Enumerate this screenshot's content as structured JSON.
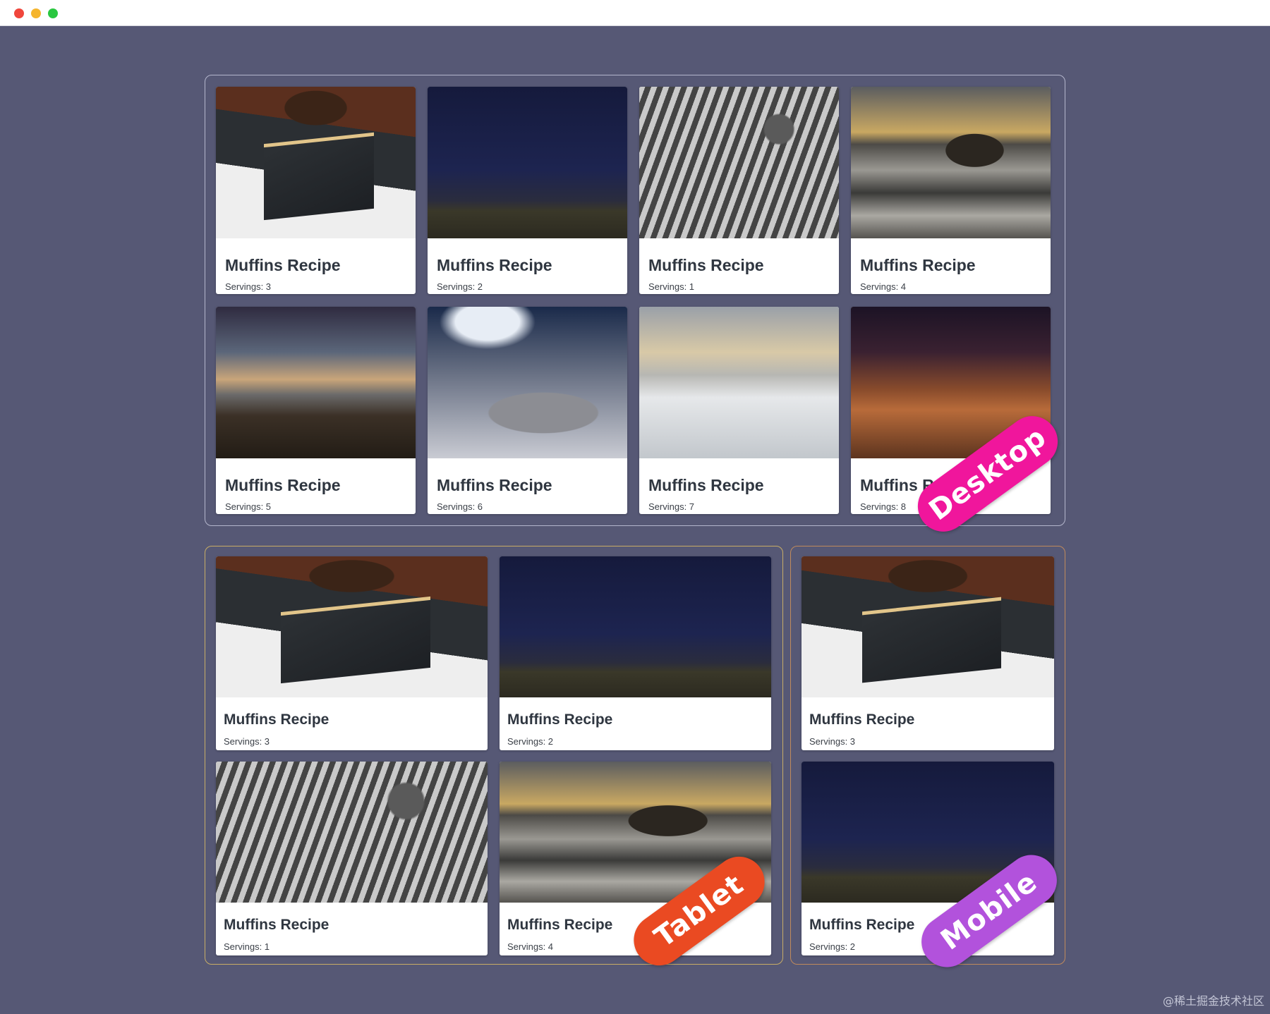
{
  "window": {
    "controls": [
      "close",
      "minimize",
      "maximize"
    ]
  },
  "colors": {
    "background": "#565875",
    "desktop_ribbon": "#f0169c",
    "tablet_ribbon": "#ea4a22",
    "mobile_ribbon": "#b252dc"
  },
  "desktop": {
    "label": "Desktop",
    "cards": [
      {
        "title": "Muffins Recipe",
        "servings": "Servings: 3",
        "photo": "boy-reading-bible"
      },
      {
        "title": "Muffins Recipe",
        "servings": "Servings: 2",
        "photo": "night-sky"
      },
      {
        "title": "Muffins Recipe",
        "servings": "Servings: 1",
        "photo": "pine-cones"
      },
      {
        "title": "Muffins Recipe",
        "servings": "Servings: 4",
        "photo": "rocky-sea"
      },
      {
        "title": "Muffins Recipe",
        "servings": "Servings: 5",
        "photo": "mountain-statue"
      },
      {
        "title": "Muffins Recipe",
        "servings": "Servings: 6",
        "photo": "phone-closeup"
      },
      {
        "title": "Muffins Recipe",
        "servings": "Servings: 7",
        "photo": "snowy-hill-cross"
      },
      {
        "title": "Muffins Recipe",
        "servings": "Servings: 8",
        "photo": "desert-dunes"
      }
    ]
  },
  "tablet": {
    "label": "Tablet",
    "cards": [
      {
        "title": "Muffins Recipe",
        "servings": "Servings: 3",
        "photo": "boy-reading-bible"
      },
      {
        "title": "Muffins Recipe",
        "servings": "Servings: 2",
        "photo": "night-sky"
      },
      {
        "title": "Muffins Recipe",
        "servings": "Servings: 1",
        "photo": "pine-cones"
      },
      {
        "title": "Muffins Recipe",
        "servings": "Servings: 4",
        "photo": "rocky-sea"
      }
    ]
  },
  "mobile": {
    "label": "Mobile",
    "cards": [
      {
        "title": "Muffins Recipe",
        "servings": "Servings: 3",
        "photo": "boy-reading-bible"
      },
      {
        "title": "Muffins Recipe",
        "servings": "Servings: 2",
        "photo": "night-sky"
      }
    ]
  },
  "watermark": "@稀土掘金技术社区"
}
